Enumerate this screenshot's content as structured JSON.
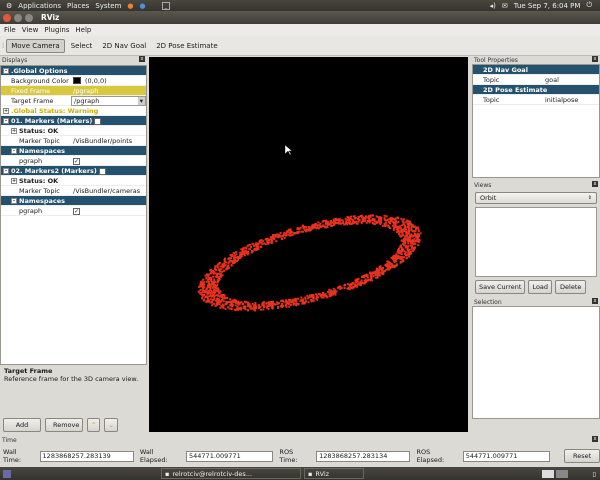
{
  "topbar": {
    "menus": [
      "Applications",
      "Places",
      "System"
    ],
    "datetime": "Tue Sep 7,  6:04 PM"
  },
  "window": {
    "title": "RViz"
  },
  "menubar": [
    "File",
    "View",
    "Plugins",
    "Help"
  ],
  "toolbar": [
    "Move Camera",
    "Select",
    "2D Nav Goal",
    "2D Pose Estimate"
  ],
  "displays": {
    "title": "Displays",
    "rows": [
      {
        "k": ".Global Options",
        "v": "",
        "style": "hdr",
        "exp": "-"
      },
      {
        "k": "Background Color",
        "v": "(0,0,0)",
        "swatch": "#000000"
      },
      {
        "k": "Fixed Frame",
        "v": "/pgraph",
        "style": "ycol"
      },
      {
        "k": "Target Frame",
        "v": "/pgraph",
        "dropdown": true
      },
      {
        "k": ".Global Status: Warning",
        "v": "",
        "style": "warn",
        "exp": "+"
      },
      {
        "k": "01. Markers (Markers)",
        "v": "",
        "style": "hdr",
        "exp": "-",
        "check": true
      },
      {
        "k": "Status: OK",
        "v": "",
        "style": "bold",
        "exp": "+",
        "indent": 1
      },
      {
        "k": "Marker Topic",
        "v": "/VisBundler/points",
        "indent": 1
      },
      {
        "k": "Namespaces",
        "v": "",
        "style": "hdr",
        "exp": "-",
        "indent": 1
      },
      {
        "k": "pgraph",
        "v": "",
        "check": true,
        "indent": 1
      },
      {
        "k": "02. Markers2 (Markers)",
        "v": "",
        "style": "hdr",
        "exp": "-",
        "check": true
      },
      {
        "k": "Status: OK",
        "v": "",
        "style": "bold",
        "exp": "+",
        "indent": 1
      },
      {
        "k": "Marker Topic",
        "v": "/VisBundler/cameras",
        "indent": 1
      },
      {
        "k": "Namespaces",
        "v": "",
        "style": "hdr",
        "exp": "-",
        "indent": 1
      },
      {
        "k": "pgraph",
        "v": "",
        "check": true,
        "indent": 1
      }
    ],
    "desc_title": "Target Frame",
    "desc_text": "Reference frame for the 3D camera view.",
    "add": "Add",
    "remove": "Remove"
  },
  "tool_properties": {
    "title": "Tool Properties",
    "rows": [
      {
        "k": "2D Nav Goal",
        "v": "",
        "style": "hdr"
      },
      {
        "k": "Topic",
        "v": "goal"
      },
      {
        "k": "2D Pose Estimate",
        "v": "",
        "style": "hdr"
      },
      {
        "k": "Topic",
        "v": "initialpose"
      }
    ]
  },
  "views": {
    "title": "Views",
    "selected": "Orbit",
    "save": "Save Current",
    "load": "Load",
    "delete": "Delete"
  },
  "selection": {
    "title": "Selection"
  },
  "time": {
    "title": "Time",
    "wall_time_label": "Wall Time:",
    "wall_time": "1283868257.283139",
    "wall_elapsed_label": "Wall Elapsed:",
    "wall_elapsed": "544771.009771",
    "ros_time_label": "ROS Time:",
    "ros_time": "1283868257.283134",
    "ros_elapsed_label": "ROS Elapsed:",
    "ros_elapsed": "544771.009771",
    "reset": "Reset"
  },
  "taskbar": [
    {
      "label": "relrotciv@relrotciv-des..."
    },
    {
      "label": "RViz"
    }
  ],
  "colors": {
    "header_blue": "#24526e",
    "fixed_frame_yellow": "#d8c83e",
    "points_red": "#e8321e"
  }
}
